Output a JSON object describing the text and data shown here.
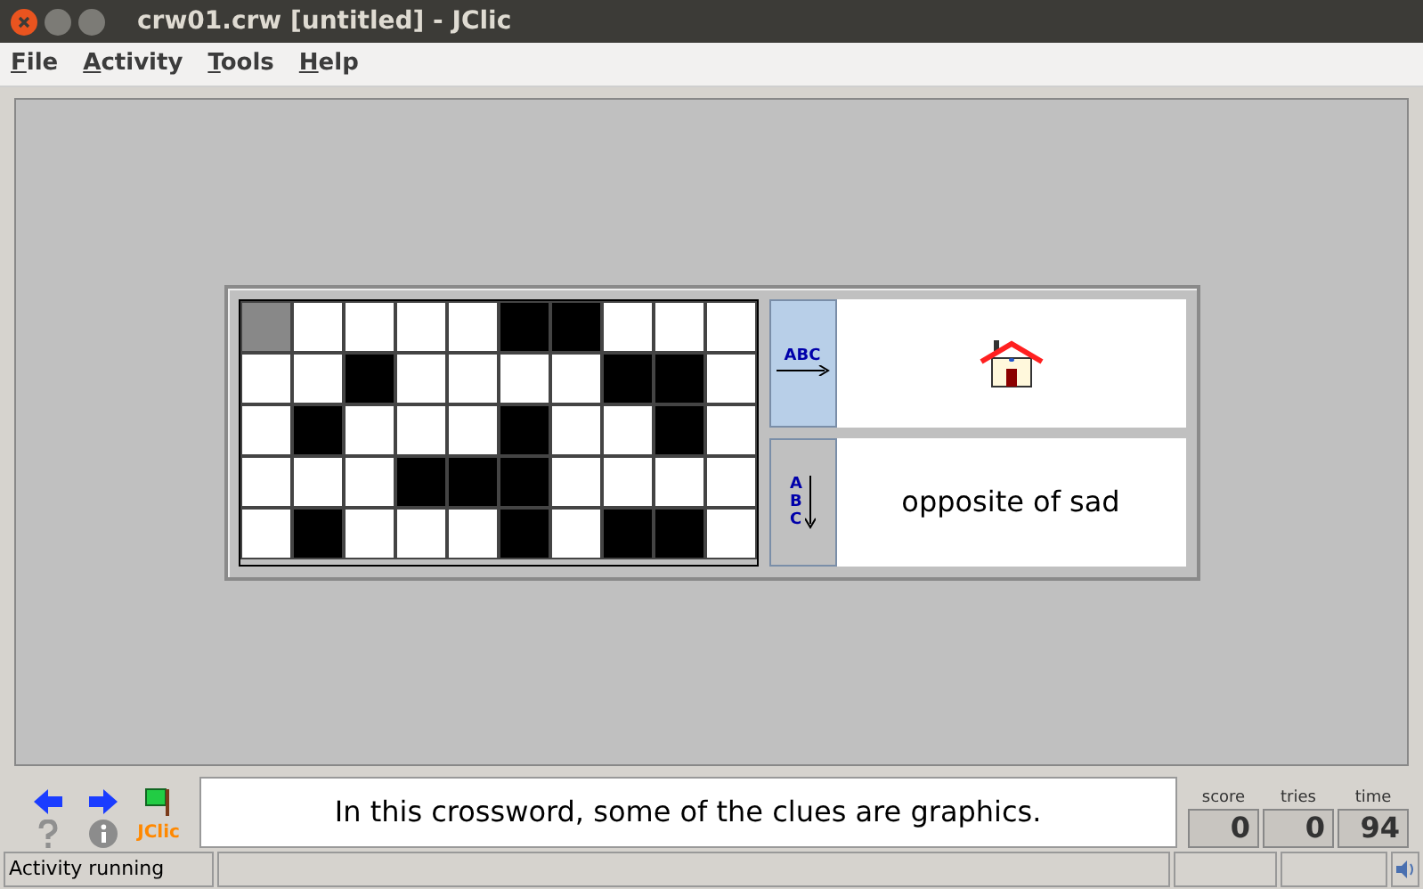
{
  "window": {
    "title": "crw01.crw [untitled] - JClic"
  },
  "menu": [
    "File",
    "Activity",
    "Tools",
    "Help"
  ],
  "crossword": {
    "rows": [
      {
        "cells": [
          {
            "kind": "white",
            "selected": true
          },
          {
            "kind": "white",
            "selected": false
          },
          {
            "kind": "white",
            "selected": false
          },
          {
            "kind": "white",
            "selected": false
          },
          {
            "kind": "white",
            "selected": false
          },
          {
            "kind": "black",
            "selected": false
          },
          {
            "kind": "black",
            "selected": false
          },
          {
            "kind": "white",
            "selected": false
          },
          {
            "kind": "white",
            "selected": false
          },
          {
            "kind": "white",
            "selected": false
          }
        ]
      },
      {
        "cells": [
          {
            "kind": "white",
            "selected": false
          },
          {
            "kind": "white",
            "selected": false
          },
          {
            "kind": "black",
            "selected": false
          },
          {
            "kind": "white",
            "selected": false
          },
          {
            "kind": "white",
            "selected": false
          },
          {
            "kind": "white",
            "selected": false
          },
          {
            "kind": "white",
            "selected": false
          },
          {
            "kind": "black",
            "selected": false
          },
          {
            "kind": "black",
            "selected": false
          },
          {
            "kind": "white",
            "selected": false
          }
        ]
      },
      {
        "cells": [
          {
            "kind": "white",
            "selected": false
          },
          {
            "kind": "black",
            "selected": false
          },
          {
            "kind": "white",
            "selected": false
          },
          {
            "kind": "white",
            "selected": false
          },
          {
            "kind": "white",
            "selected": false
          },
          {
            "kind": "black",
            "selected": false
          },
          {
            "kind": "white",
            "selected": false
          },
          {
            "kind": "white",
            "selected": false
          },
          {
            "kind": "black",
            "selected": false
          },
          {
            "kind": "white",
            "selected": false
          }
        ]
      },
      {
        "cells": [
          {
            "kind": "white",
            "selected": false
          },
          {
            "kind": "white",
            "selected": false
          },
          {
            "kind": "white",
            "selected": false
          },
          {
            "kind": "black",
            "selected": false
          },
          {
            "kind": "black",
            "selected": false
          },
          {
            "kind": "black",
            "selected": false
          },
          {
            "kind": "white",
            "selected": false
          },
          {
            "kind": "white",
            "selected": false
          },
          {
            "kind": "white",
            "selected": false
          },
          {
            "kind": "white",
            "selected": false
          }
        ]
      },
      {
        "cells": [
          {
            "kind": "white",
            "selected": false
          },
          {
            "kind": "black",
            "selected": false
          },
          {
            "kind": "white",
            "selected": false
          },
          {
            "kind": "white",
            "selected": false
          },
          {
            "kind": "white",
            "selected": false
          },
          {
            "kind": "black",
            "selected": false
          },
          {
            "kind": "white",
            "selected": false
          },
          {
            "kind": "black",
            "selected": false
          },
          {
            "kind": "black",
            "selected": false
          },
          {
            "kind": "white",
            "selected": false
          }
        ]
      }
    ]
  },
  "clues": [
    {
      "vertical": false,
      "label": "ABC",
      "selected": true,
      "kind": "image"
    },
    {
      "vertical": true,
      "label": "ABC",
      "selected": false,
      "kind": "text",
      "text": "opposite of sad"
    }
  ],
  "logo": "JClic",
  "message": "In this crossword, some of the clues are graphics.",
  "counters": [
    {
      "label": "score",
      "value": "0"
    },
    {
      "label": "tries",
      "value": "0"
    },
    {
      "label": "time",
      "value": "94"
    }
  ],
  "status_bar": {
    "text": "Activity running"
  }
}
